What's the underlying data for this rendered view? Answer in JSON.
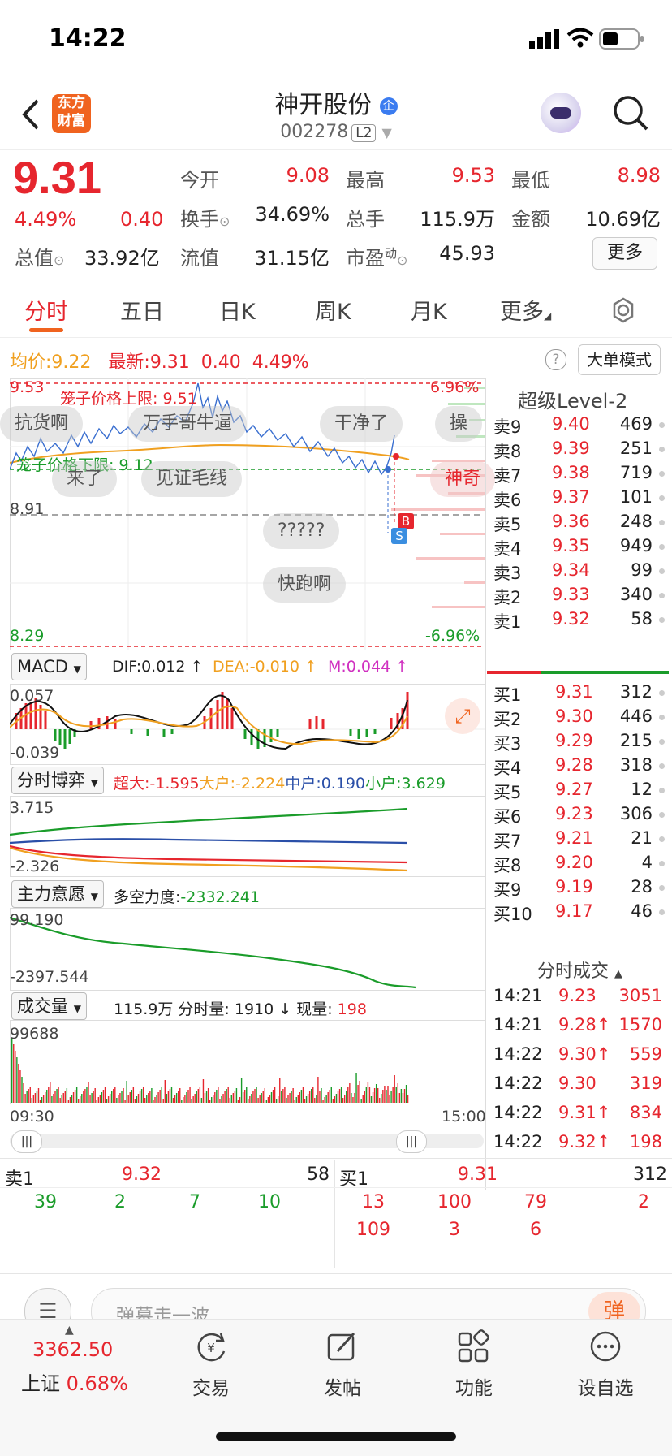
{
  "status_bar": {
    "time": "14:22"
  },
  "header": {
    "logo_line1": "东方",
    "logo_line2": "财富",
    "stock_name": "神开股份",
    "stock_code": "002278",
    "level_badge": "L2"
  },
  "quote": {
    "price": "9.31",
    "change_pct": "4.49%",
    "change": "0.40",
    "open_label": "今开",
    "open": "9.08",
    "high_label": "最高",
    "high": "9.53",
    "low_label": "最低",
    "low": "8.98",
    "turnover_label": "换手",
    "turnover": "34.69%",
    "volume_label": "总手",
    "volume": "115.9万",
    "amount_label": "金额",
    "amount": "10.69亿",
    "mktcap_label": "总值",
    "mktcap": "33.92亿",
    "float_label": "流值",
    "float_cap": "31.15亿",
    "pe_label": "市盈",
    "pe_sup": "动",
    "pe": "45.93",
    "more_label": "更多"
  },
  "tabs": [
    "分时",
    "五日",
    "日K",
    "周K",
    "月K",
    "更多"
  ],
  "summary": {
    "avg_label": "均价:",
    "avg": "9.22",
    "latest_label": "最新:",
    "latest": "9.31",
    "chg": "0.40",
    "chg_pct": "4.49%",
    "big_order_mode": "大单模式"
  },
  "intraday": {
    "y_top": "9.53",
    "y_mid": "8.91",
    "y_bottom": "8.29",
    "pct_top": "6.96%",
    "pct_bottom": "-6.96%",
    "upper_limit": "笼子价格上限: 9.51",
    "lower_limit": "笼子价格下限: 9.12",
    "danmu": [
      "抗货啊",
      "万手哥牛逼",
      "干净了",
      "操",
      "来了",
      "见证毛线",
      "神奇",
      "?????",
      "快跑啊"
    ],
    "marker_b": "B",
    "marker_s": "S"
  },
  "macd": {
    "name": "MACD",
    "dif": "DIF:0.012 ↑",
    "dea": "DEA:-0.010 ↑",
    "m": "M:0.044 ↑",
    "y_top": "0.057",
    "y_bottom": "-0.039"
  },
  "game": {
    "name": "分时博弈",
    "super": "超大:-1.595",
    "large": "大户:-2.224",
    "mid": "中户:0.190",
    "small": "小户:3.629",
    "y_top": "3.715",
    "y_bottom": "-2.326"
  },
  "intent": {
    "name": "主力意愿",
    "force": "多空力度:",
    "force_val": "-2332.241",
    "y_top": "99.190",
    "y_bottom": "-2397.544"
  },
  "vol": {
    "name": "成交量",
    "text": "115.9万 分时量: 1910 ↓ 现量: ",
    "now": "198",
    "y_top": "99688",
    "t_start": "09:30",
    "t_end": "15:00"
  },
  "level2": {
    "title": "超级Level-2",
    "asks": [
      [
        "卖9",
        "9.40",
        "469"
      ],
      [
        "卖8",
        "9.39",
        "251"
      ],
      [
        "卖7",
        "9.38",
        "719"
      ],
      [
        "卖6",
        "9.37",
        "101"
      ],
      [
        "卖5",
        "9.36",
        "248"
      ],
      [
        "卖4",
        "9.35",
        "949"
      ],
      [
        "卖3",
        "9.34",
        "99"
      ],
      [
        "卖2",
        "9.33",
        "340"
      ],
      [
        "卖1",
        "9.32",
        "58"
      ]
    ],
    "bids": [
      [
        "买1",
        "9.31",
        "312"
      ],
      [
        "买2",
        "9.30",
        "446"
      ],
      [
        "买3",
        "9.29",
        "215"
      ],
      [
        "买4",
        "9.28",
        "318"
      ],
      [
        "买5",
        "9.27",
        "12"
      ],
      [
        "买6",
        "9.23",
        "306"
      ],
      [
        "买7",
        "9.21",
        "21"
      ],
      [
        "买8",
        "9.20",
        "4"
      ],
      [
        "买9",
        "9.19",
        "28"
      ],
      [
        "买10",
        "9.17",
        "46"
      ]
    ]
  },
  "ticks": {
    "title": "分时成交",
    "rows": [
      [
        "14:21",
        "9.23",
        "3051"
      ],
      [
        "14:21",
        "9.28↑",
        "1570"
      ],
      [
        "14:22",
        "9.30↑",
        "559"
      ],
      [
        "14:22",
        "9.30",
        "319"
      ],
      [
        "14:22",
        "9.31↑",
        "834"
      ],
      [
        "14:22",
        "9.32↑",
        "198"
      ]
    ]
  },
  "queue": {
    "ask_label": "卖1",
    "ask_price": "9.32",
    "ask_vol": "58",
    "ask_orders": [
      "39",
      "2",
      "7",
      "10"
    ],
    "bid_label": "买1",
    "bid_price": "9.31",
    "bid_vol": "312",
    "bid_orders": [
      "13",
      "100",
      "79",
      "2",
      "109",
      "3",
      "6"
    ]
  },
  "comment": {
    "placeholder": "弹幕走一波...",
    "danmu_btn": "弹"
  },
  "footer": {
    "index_value": "3362.50",
    "index_name": "上证",
    "index_pct": "0.68%",
    "trade": "交易",
    "post": "发帖",
    "func": "功能",
    "watch": "设自选"
  }
}
